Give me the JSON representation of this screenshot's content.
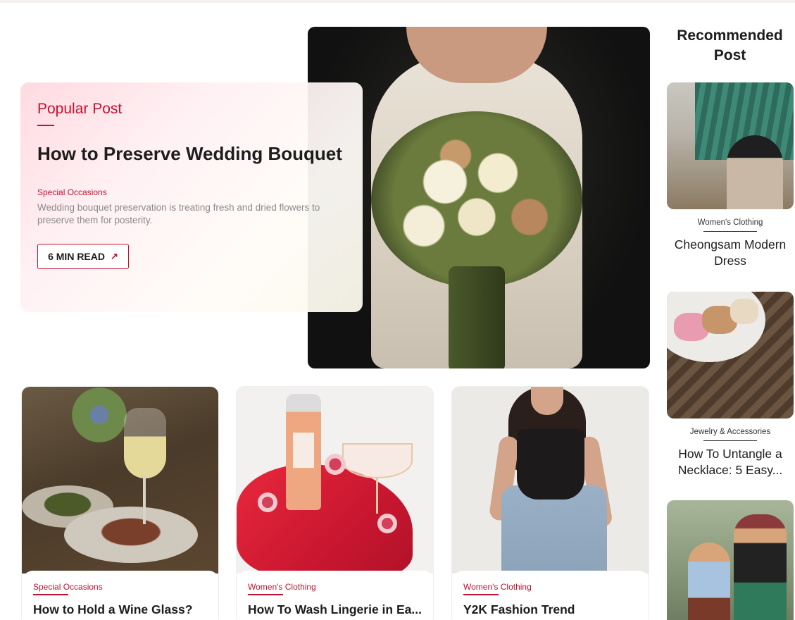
{
  "hero": {
    "image_alt": "bride holding wedding bouquet",
    "label": "Popular Post",
    "title": "How to Preserve Wedding Bouquet",
    "category": "Special Occasions",
    "description": "Wedding bouquet preservation is treating fresh and dried flowers to preserve them for posterity.",
    "read_button": "6 MIN READ",
    "read_icon": "arrow-up-right-icon"
  },
  "posts": [
    {
      "category": "Special Occasions",
      "title": "How to Hold a Wine Glass?",
      "image": "wine-glass-food-photo"
    },
    {
      "category": "Women's Clothing",
      "title": "How To Wash Lingerie in Ea...",
      "image": "lingerie-flatlay-photo"
    },
    {
      "category": "Women's Clothing",
      "title": "Y2K Fashion Trend",
      "image": "y2k-fashion-photo"
    }
  ],
  "recommended": {
    "heading": "Recommended Post",
    "items": [
      {
        "category": "Women's Clothing",
        "title": "Cheongsam Modern Dress",
        "image": "cheongsam-photo"
      },
      {
        "category": "Jewelry & Accessories",
        "title": "How To Untangle a Necklace: 5 Easy...",
        "image": "macarons-photo"
      },
      {
        "category": "",
        "title": "",
        "image": "two-women-street-photo"
      }
    ]
  },
  "colors": {
    "accent": "#c2122f",
    "text": "#1d1d1d",
    "muted": "#8a8a8a"
  }
}
